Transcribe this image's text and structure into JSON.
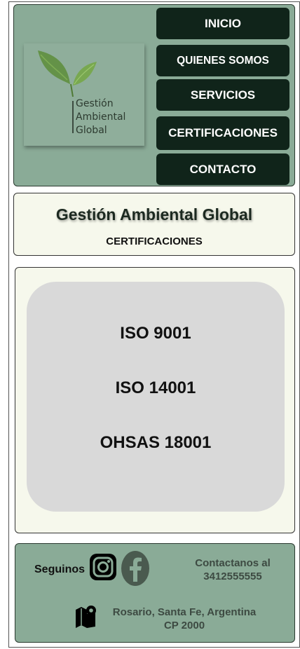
{
  "header": {
    "logo": {
      "line1": "Gestión",
      "line2": "Ambiental",
      "line3": "Global"
    },
    "nav": [
      {
        "label": "INICIO"
      },
      {
        "label": "QUIENES SOMOS"
      },
      {
        "label": "SERVICIOS"
      },
      {
        "label": "CERTIFICACIONES"
      },
      {
        "label": "CONTACTO"
      }
    ]
  },
  "title": {
    "main": "Gestión Ambiental Global",
    "sub": "CERTIFICACIONES"
  },
  "certifications": [
    {
      "name": "ISO 9001"
    },
    {
      "name": "ISO 14001"
    },
    {
      "name": "OHSAS 18001"
    }
  ],
  "footer": {
    "follow_label": "Seguinos",
    "social_icons": [
      "instagram-icon",
      "facebook-icon"
    ],
    "contact_line1": "Contactanos al",
    "contact_phone": "3412555555",
    "address_line1": "Rosario, Santa Fe, Argentina",
    "address_line2": "CP 2000",
    "location_icon": "map-pin-icon"
  },
  "colors": {
    "header_bg": "#8aab97",
    "nav_button_bg": "#10241a",
    "panel_bg": "#f6f8ec",
    "card_bg": "#d9d9d9"
  }
}
